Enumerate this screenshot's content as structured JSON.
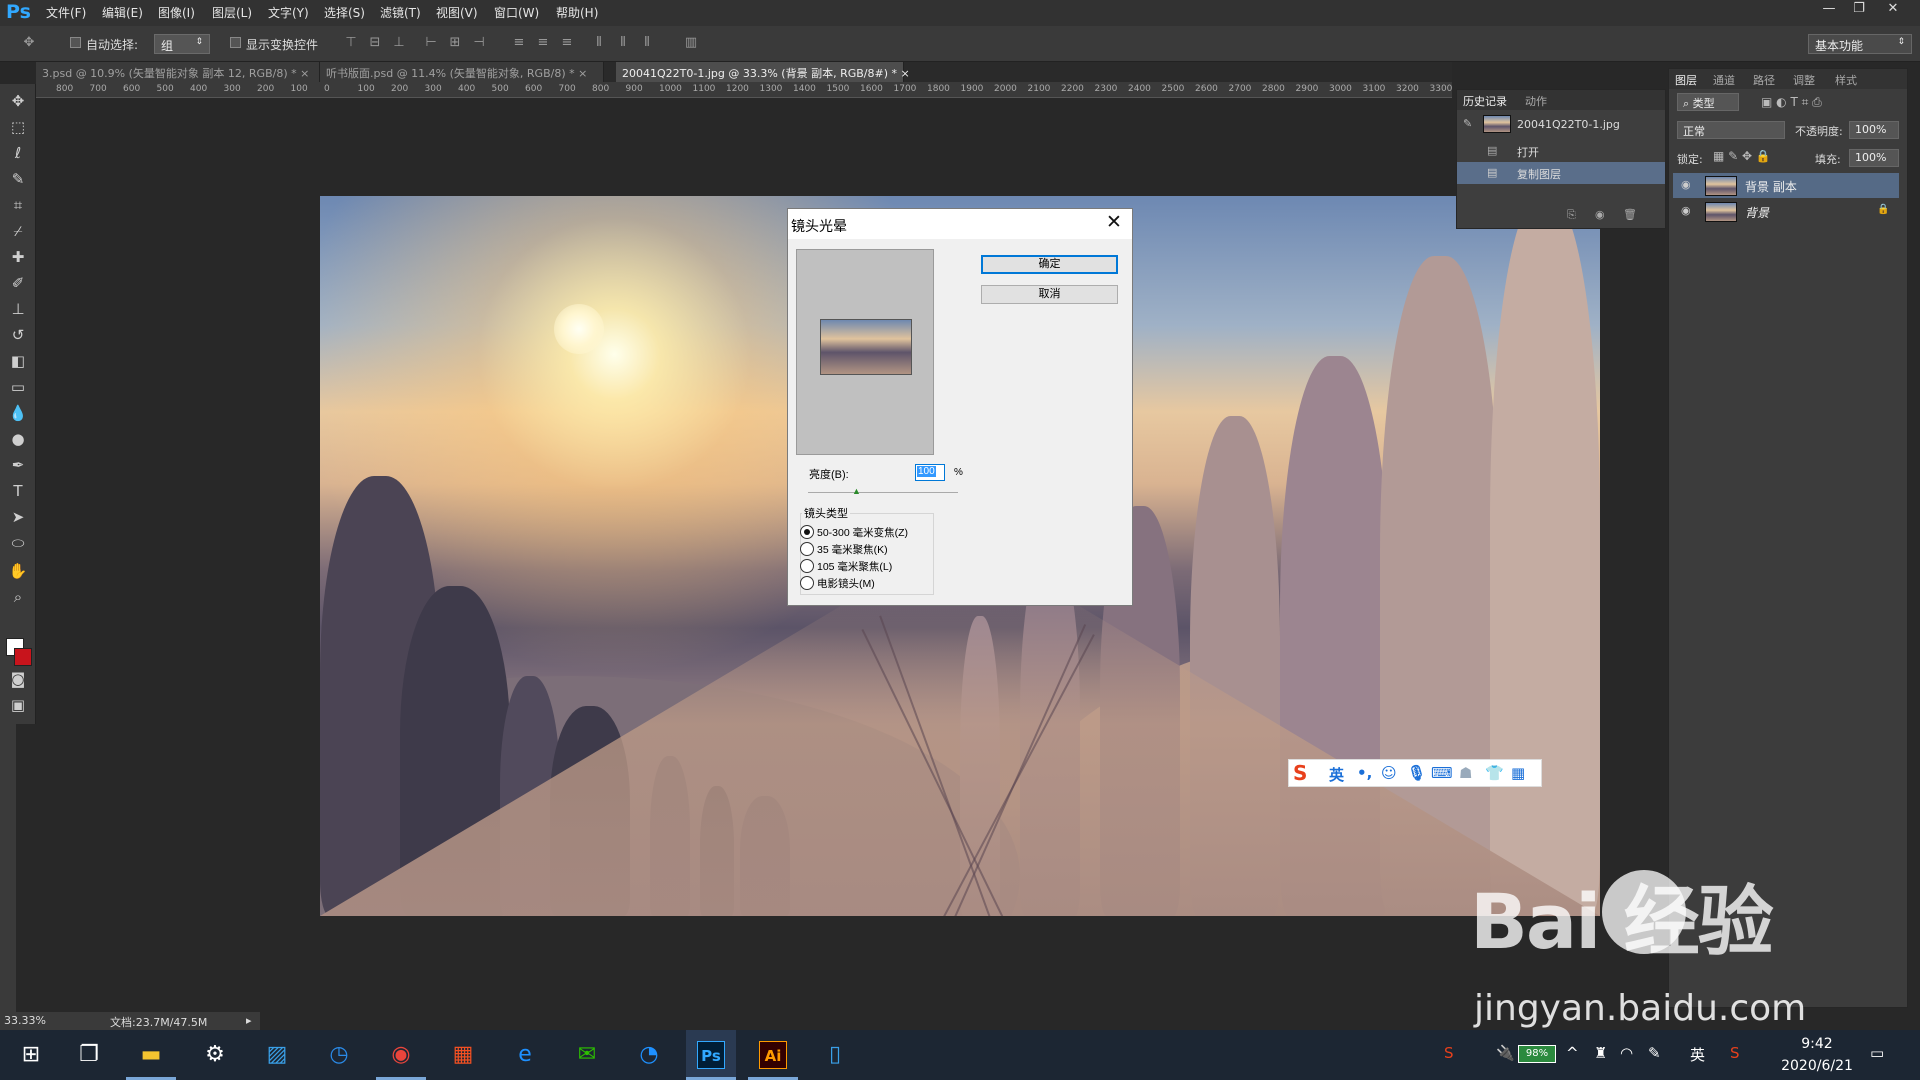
{
  "app": {
    "logo": "Ps"
  },
  "menu": [
    "文件(F)",
    "编辑(E)",
    "图像(I)",
    "图层(L)",
    "文字(Y)",
    "选择(S)",
    "滤镜(T)",
    "视图(V)",
    "窗口(W)",
    "帮助(H)"
  ],
  "window_controls": {
    "minimize": "—",
    "restore": "❐",
    "close": "✕"
  },
  "options": {
    "auto_select_label": "自动选择:",
    "auto_select_value": "组",
    "show_transform_label": "显示变换控件",
    "workspace": "基本功能"
  },
  "tabs": [
    {
      "label": "3.psd @ 10.9% (矢量智能对象 副本 12, RGB/8) *",
      "close": "×"
    },
    {
      "label": "听书版面.psd @ 11.4% (矢量智能对象, RGB/8) *",
      "close": "×"
    },
    {
      "label": "20041Q22T0-1.jpg @ 33.3% (背景 副本, RGB/8#) *",
      "close": "×"
    }
  ],
  "ruler_ticks": [
    "800",
    "700",
    "600",
    "500",
    "400",
    "300",
    "200",
    "100",
    "0",
    "100",
    "200",
    "300",
    "400",
    "500",
    "600",
    "700",
    "800",
    "900",
    "1000",
    "1100",
    "1200",
    "1300",
    "1400",
    "1500",
    "1600",
    "1700",
    "1800",
    "1900",
    "2000",
    "2100",
    "2200",
    "2300",
    "2400",
    "2500",
    "2600",
    "2700",
    "2800",
    "2900",
    "3000",
    "3100",
    "3200",
    "3300"
  ],
  "dialog": {
    "title": "镜头光晕",
    "ok": "确定",
    "cancel": "取消",
    "brightness_label": "亮度(B):",
    "brightness_value": "100",
    "brightness_unit": "%",
    "lens_type_label": "镜头类型",
    "lens_options": [
      "50-300 毫米变焦(Z)",
      "35 毫米聚焦(K)",
      "105 毫米聚焦(L)",
      "电影镜头(M)"
    ],
    "lens_selected": 0
  },
  "history_panel": {
    "tabs": [
      "历史记录",
      "动作"
    ],
    "snapshot": "20041Q22T0-1.jpg",
    "items": [
      "打开",
      "复制图层"
    ],
    "selected": 1
  },
  "layers_panel": {
    "tabs": [
      "图层",
      "通道",
      "路径",
      "调整",
      "样式"
    ],
    "filter_kind": "类型",
    "blend_mode": "正常",
    "opacity_label": "不透明度:",
    "opacity_value": "100%",
    "lock_label": "锁定:",
    "fill_label": "填充:",
    "fill_value": "100%",
    "layers": [
      {
        "name": "背景 副本",
        "selected": true
      },
      {
        "name": "背景",
        "selected": false
      }
    ]
  },
  "status": {
    "zoom": "33.33%",
    "doc": "文档:23.7M/47.5M"
  },
  "ime": {
    "lang": "英"
  },
  "watermark": {
    "brand": "Bai  经验",
    "url": "jingyan.baidu.com"
  },
  "taskbar": {
    "apps": [
      "start-icon",
      "task-view-icon",
      "file-explorer-icon",
      "settings-icon",
      "photos-icon",
      "clock-app-icon",
      "chrome-icon",
      "store-icon",
      "ie-icon",
      "wechat-icon",
      "qq-browser-icon",
      "photoshop-icon",
      "illustrator-icon",
      "phone-icon"
    ],
    "ps_label": "Ps",
    "ai_label": "Ai",
    "battery": "98%",
    "ime_lang": "英",
    "time": "9:42",
    "date": "2020/6/21"
  }
}
